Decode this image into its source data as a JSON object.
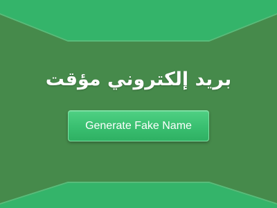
{
  "hero": {
    "title": "بريد إلكتروني مؤقت"
  },
  "actions": {
    "generate_label": "Generate Fake Name"
  },
  "colors": {
    "background": "#468a4b",
    "banner": "#35b86a",
    "button": "#3fc275",
    "text": "#ffffff"
  }
}
